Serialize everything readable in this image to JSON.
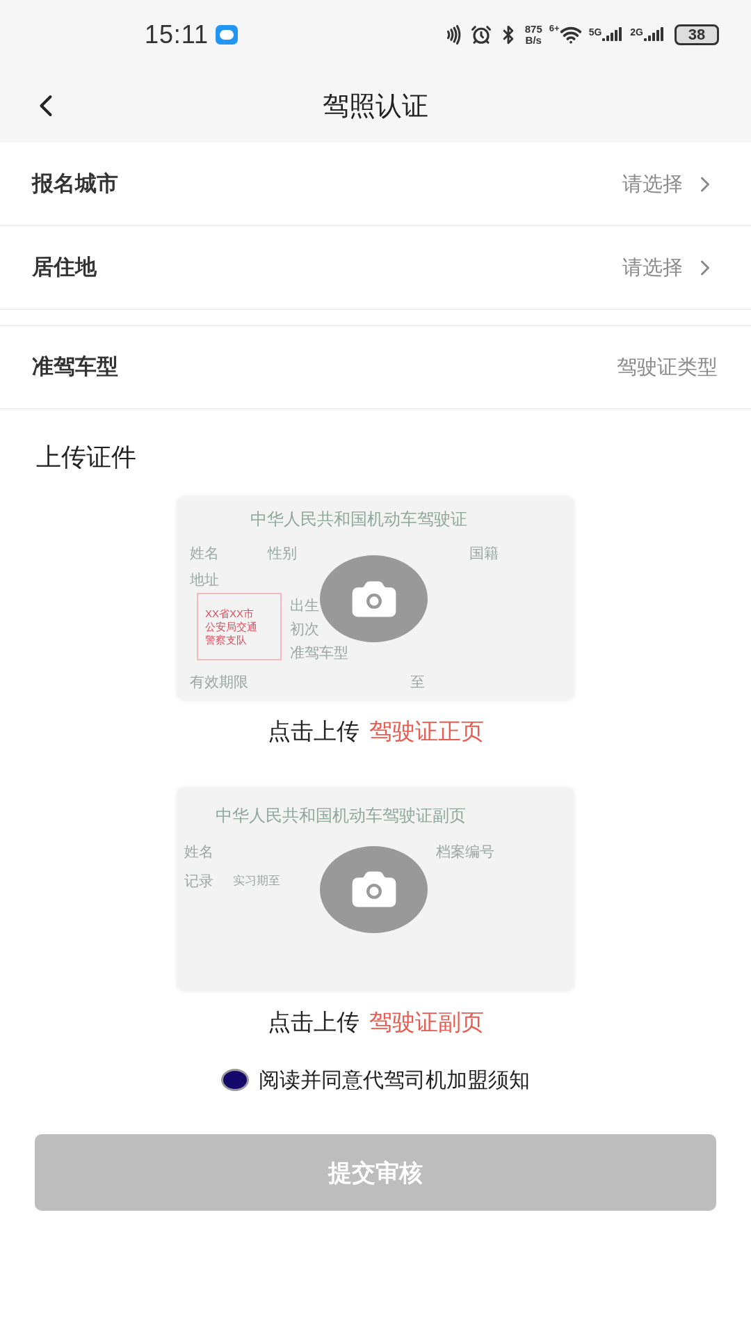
{
  "status_bar": {
    "time": "15:11",
    "net_speed": [
      "875",
      "B/s"
    ],
    "wifi_label": "6+",
    "signals": [
      {
        "label": "5G"
      },
      {
        "label": "2G"
      }
    ],
    "battery": "38"
  },
  "header": {
    "title": "驾照认证"
  },
  "form_groups": [
    [
      {
        "label": "报名城市",
        "value": "请选择",
        "kind": "select"
      },
      {
        "label": "居住地",
        "value": "请选择",
        "kind": "select"
      }
    ],
    [
      {
        "label": "准驾车型",
        "value": "驾驶证类型",
        "kind": "text"
      }
    ]
  ],
  "upload": {
    "title": "上传证件",
    "cards": [
      {
        "kind": "front",
        "title": "中华人民共和国机动车驾驶证",
        "row1": [
          "姓名",
          "性别",
          "国籍"
        ],
        "address": "地址",
        "stamp": [
          "XX省XX市",
          "公安局交通",
          "警察支队"
        ],
        "side": [
          "出生",
          "初次",
          "准驾车型"
        ],
        "validity": [
          "有效期限",
          "至"
        ],
        "caption": "点击上传",
        "caption_highlight": "驾驶证正页"
      },
      {
        "kind": "back",
        "title": "中华人民共和国机动车驾驶证副页",
        "row1": [
          "姓名",
          "档案编号"
        ],
        "row2": [
          "记录",
          "实习期至"
        ],
        "caption": "点击上传",
        "caption_highlight": "驾驶证副页"
      }
    ]
  },
  "agreement": {
    "text": "阅读并同意代驾司机加盟须知",
    "checked": true
  },
  "submit": {
    "label": "提交审核",
    "disabled": true
  }
}
